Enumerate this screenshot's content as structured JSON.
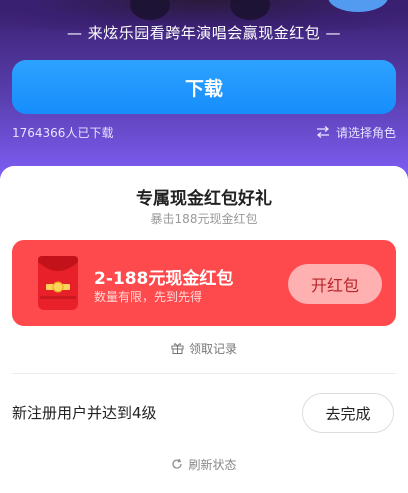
{
  "promo": {
    "tagline": "— 来炫乐园看跨年演唱会赢现金红包 —",
    "download_label": "下载",
    "download_count": "1764366人已下载",
    "role_select_label": "请选择角色"
  },
  "reward_card": {
    "title": "专属现金红包好礼",
    "subtitle": "暴击188元现金红包",
    "packet": {
      "title": "2-188元现金红包",
      "subtitle": "数量有限，先到先得",
      "open_label": "开红包"
    },
    "records_label": "领取记录",
    "task": {
      "label": "新注册用户并达到4级",
      "action_label": "去完成"
    },
    "refresh_label": "刷新状态"
  },
  "colors": {
    "accent_blue": "#168dfb",
    "packet_red": "#ff4a4d",
    "open_button": "#ffb1b1"
  },
  "icons": [
    "swap-icon",
    "red-packet-icon",
    "gift-box-icon",
    "refresh-icon"
  ]
}
